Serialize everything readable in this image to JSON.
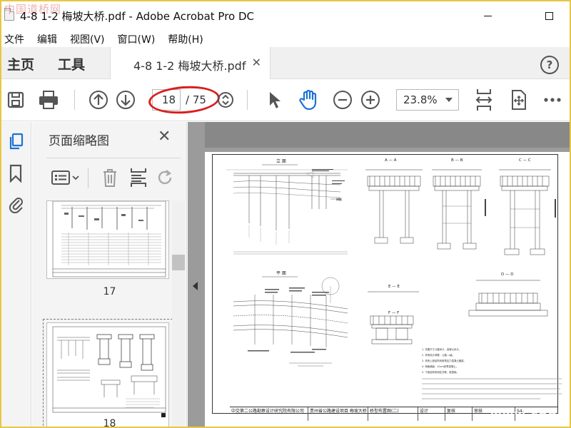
{
  "window": {
    "title": "4-8 1-2 梅坡大桥.pdf - Adobe Acrobat Pro DC",
    "watermark": "中国道桥网"
  },
  "menu": [
    "文件",
    "编辑",
    "视图(V)",
    "窗口(W)",
    "帮助(H)"
  ],
  "tabs": {
    "home": "主页",
    "tools": "工具",
    "document": "4-8 1-2 梅坡大桥.pdf"
  },
  "toolbar": {
    "current_page": "18",
    "total_pages": "/ 75",
    "zoom": "23.8%"
  },
  "panel": {
    "title": "页面缩略图",
    "thumbnails": [
      {
        "page": "17"
      },
      {
        "page": "18"
      }
    ]
  },
  "drawing": {
    "labels": {
      "elevation": "立 面",
      "plan": "平 面",
      "section_aa": "A — A",
      "section_bb": "B — B",
      "section_cc": "C — C",
      "section_dd": "D — D",
      "section_ee": "E — E",
      "section_ff": "F — F",
      "to_meipo": "梅坡"
    },
    "notes": [
      "1. 本图尺寸以厘米计，高程以米计。",
      "2. 本桥设计荷载：公路—I级。",
      "3. 本桥上部结构采用预应力混凝土箱梁。",
      "4. 桥面铺装：10cm沥青混凝土。",
      "5. 下部结构采用柱式墩、桩基础。"
    ],
    "title_block": {
      "company": "中交第二公路勘察设计研究院有限公司",
      "project": "贵州省公路建设项目 梅坡大桥",
      "drawing": "桥型布置图(二)",
      "design": "设计",
      "review": "复核",
      "approve": "审核",
      "sheet": "S4-"
    }
  },
  "site_mark": "www.chdao.com",
  "colors": {
    "annotation_red": "#d81e1e",
    "window_border": "#e7c744",
    "doc_background": "#9b9b9b",
    "accent_blue": "#1b73d2"
  }
}
